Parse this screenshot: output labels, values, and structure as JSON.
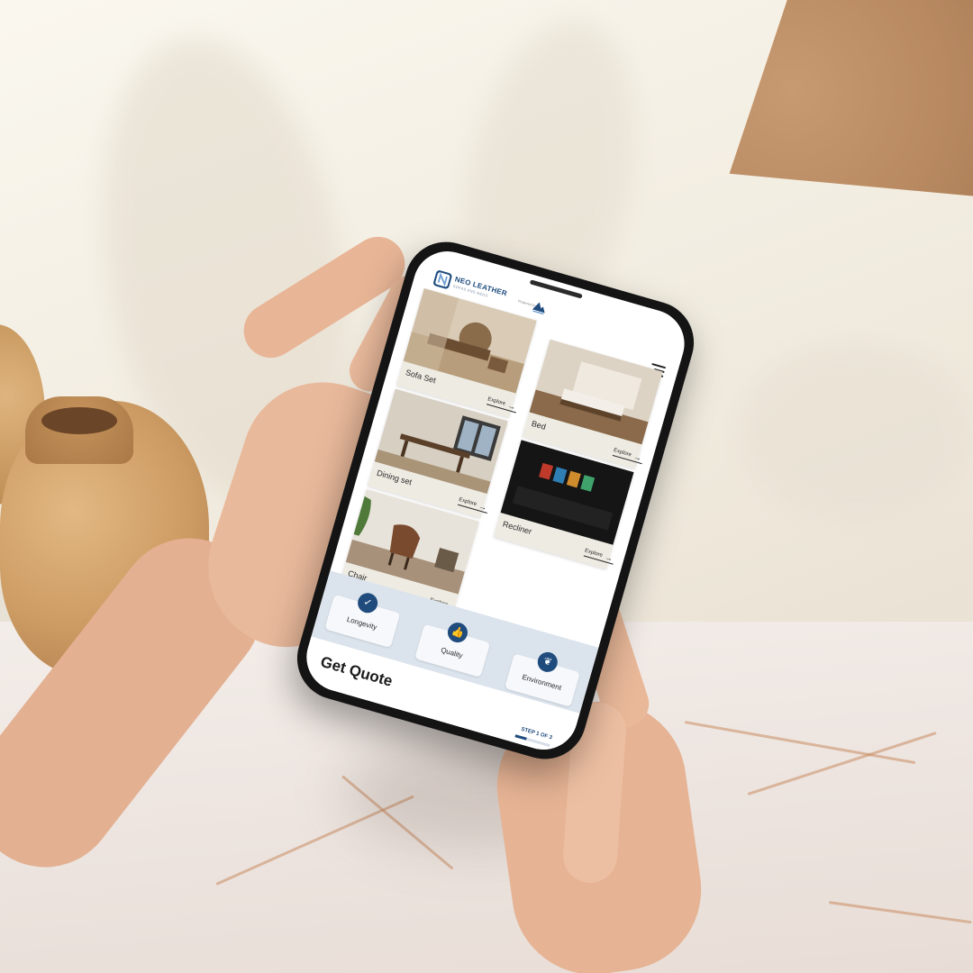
{
  "app": {
    "brand_name": "NEO LEATHER",
    "brand_tagline": "SOFAS AND BEDS",
    "byline": "Powered by"
  },
  "categories": [
    {
      "name": "Sofa Set",
      "action": "Explore"
    },
    {
      "name": "Bed",
      "action": "Explore"
    },
    {
      "name": "Dining set",
      "action": "Explore"
    },
    {
      "name": "Recliner",
      "action": "Explore"
    },
    {
      "name": "Chair",
      "action": "Explore"
    }
  ],
  "values": [
    {
      "label": "Longevity",
      "icon": "check-badge-icon"
    },
    {
      "label": "Quality",
      "icon": "thumbs-up-icon"
    },
    {
      "label": "Environment",
      "icon": "leaf-icon"
    }
  ],
  "quote": {
    "title": "Get Quote",
    "step_label": "STEP 1 OF 3",
    "progress": 0.33
  },
  "colors": {
    "accent": "#1f4b7d",
    "values_band": "#dbe3ec",
    "card_bg": "#eeebe2"
  }
}
